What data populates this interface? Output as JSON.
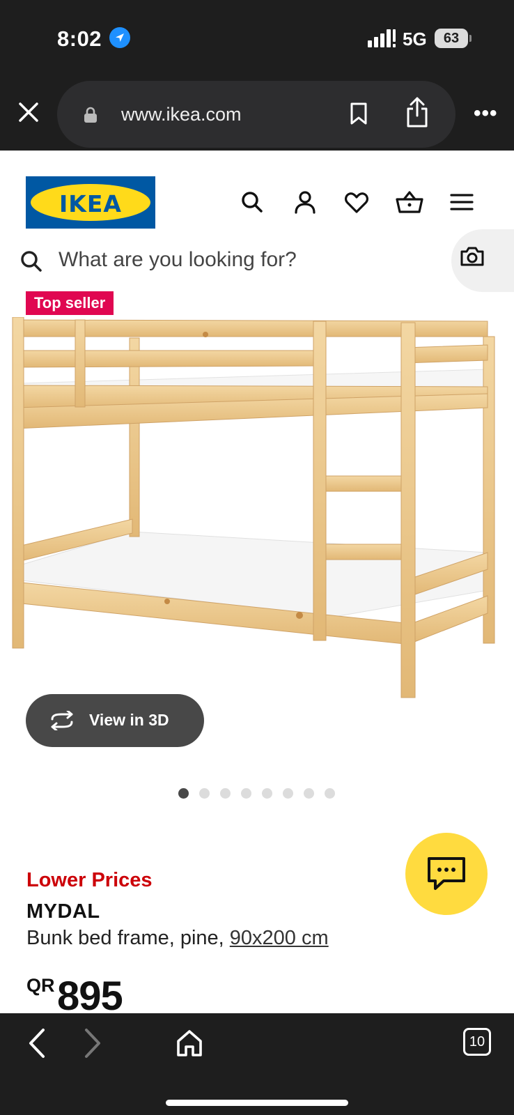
{
  "status_bar": {
    "time": "8:02",
    "network": "5G",
    "battery": "63",
    "icons": [
      "location-arrow-icon",
      "signal-icon",
      "battery-icon"
    ]
  },
  "browser": {
    "url": "www.ikea.com",
    "tab_count": "10",
    "icons": [
      "close-icon",
      "lock-icon",
      "bookmark-icon",
      "share-icon",
      "more-icon",
      "back-icon",
      "forward-icon",
      "home-icon",
      "tabs-icon"
    ]
  },
  "header": {
    "logo_text": "IKEA",
    "icons": [
      "search-icon",
      "account-icon",
      "wishlist-icon",
      "cart-icon",
      "menu-icon"
    ]
  },
  "search": {
    "placeholder": "What are you looking for?",
    "camera_icon": "camera-icon"
  },
  "product": {
    "badge": "Top seller",
    "view_3d_label": "View in 3D",
    "image_count": 8,
    "active_image_index": 0,
    "price_note": "Lower Prices",
    "name": "MYDAL",
    "description": "Bunk bed frame, pine, ",
    "size": "90x200 cm",
    "currency": "QR",
    "price": "895"
  },
  "colors": {
    "ikea_blue": "#0058a3",
    "ikea_yellow": "#ffda1a",
    "badge_pink": "#e00751",
    "price_note_red": "#cc0008",
    "chat_yellow": "#ffdb3f",
    "browser_dark": "#1e1e1e"
  }
}
